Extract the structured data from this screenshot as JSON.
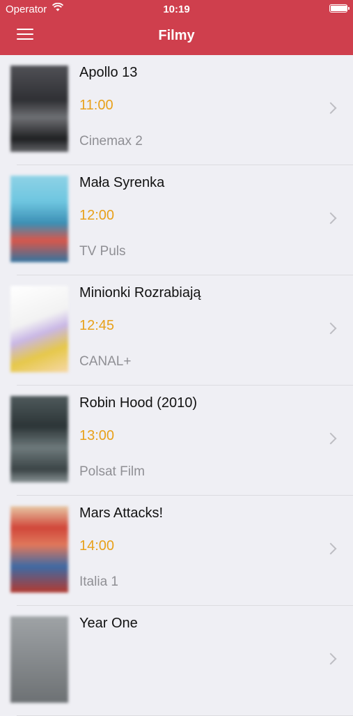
{
  "status_bar": {
    "carrier": "Operator",
    "time": "10:19",
    "battery_level": 1.0
  },
  "nav": {
    "title": "Filmy"
  },
  "movies": [
    {
      "title": "Apollo 13",
      "time": "11:00",
      "channel": "Cinemax 2"
    },
    {
      "title": "Mała Syrenka",
      "time": "12:00",
      "channel": "TV Puls"
    },
    {
      "title": "Minionki Rozrabiają",
      "time": "12:45",
      "channel": "CANAL+"
    },
    {
      "title": "Robin Hood (2010)",
      "time": "13:00",
      "channel": "Polsat Film"
    },
    {
      "title": "Mars Attacks!",
      "time": "14:00",
      "channel": "Italia 1"
    },
    {
      "title": "Year One",
      "time": "",
      "channel": ""
    }
  ],
  "colors": {
    "header": "#cf3f4d",
    "time_accent": "#e8a11b",
    "channel_text": "#8f8f94"
  }
}
